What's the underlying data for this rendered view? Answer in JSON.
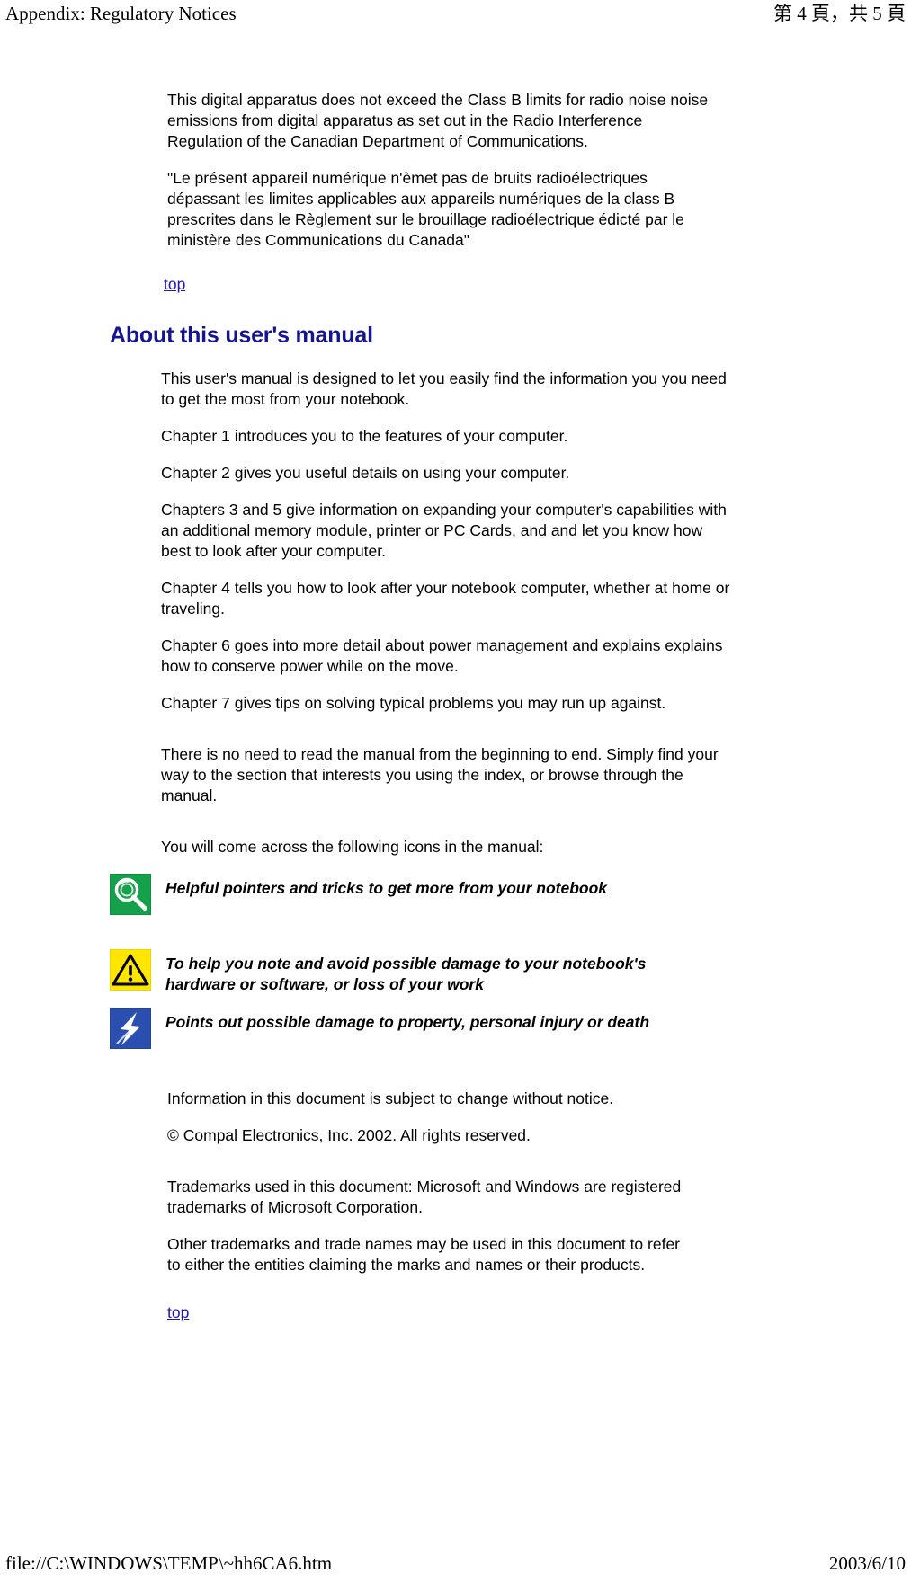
{
  "header": {
    "left_title": "Appendix: Regulatory Notices",
    "right_pagination": "第 4 頁，共 5 頁"
  },
  "footer": {
    "file_path": "file://C:\\WINDOWS\\TEMP\\~hh6CA6.htm",
    "date": "2003/6/10"
  },
  "colors": {
    "heading_navy": "#151590",
    "link_blue": "#2014b4",
    "icon_green": "#14a04a",
    "icon_yellow": "#ffe500",
    "icon_blue": "#2a4fb0",
    "page_background": "#ffffff",
    "body_text": "#000000"
  },
  "regulatory": {
    "paragraphs": [
      "This digital apparatus does not exceed the Class B limits for radio noise noise emissions from digital apparatus as set out in the Radio Interference Regulation of the Canadian Department of Communications.",
      "\"Le présent appareil numérique n'èmet pas de bruits radioélectriques dépassant les limites applicables aux appareils numériques de la class B prescrites dans le Règlement sur le brouillage radioélectrique édicté par le ministère des Communications du Canada\""
    ],
    "top_link": "top"
  },
  "about_section": {
    "heading": "About this user's manual",
    "paragraphs": [
      "This user's manual is designed to let you easily find the information you you need to get the most from your notebook.",
      "Chapter 1 introduces you to the features of your computer.",
      "Chapter 2 gives you useful details on using your computer.",
      "Chapters 3 and 5 give information on expanding your computer's capabilities with an additional memory module, printer or PC Cards, and and let you know how best to look after your computer.",
      "Chapter 4 tells you how to look after your notebook computer, whether at home or traveling.",
      "Chapter 6 goes into more detail about power management and explains explains how to conserve power while on the move.",
      "Chapter 7 gives tips on solving typical problems you may run up against.",
      "There is no need to read the manual from the beginning to end. Simply find your way to the section that interests you using the index, or browse through the manual.",
      "You will come across the following icons in the manual:"
    ]
  },
  "icon_legend": [
    {
      "icon_name": "magnifier-tip-icon",
      "icon_kind": "magnifier",
      "text": "Helpful pointers and tricks to get more from your notebook"
    },
    {
      "icon_name": "warning-triangle-icon",
      "icon_kind": "warning",
      "text": "To help you note and avoid possible damage to your notebook's hardware or software, or loss of your work"
    },
    {
      "icon_name": "lightning-bolt-danger-icon",
      "icon_kind": "lightning",
      "text": "Points out possible damage to property, personal injury or death"
    }
  ],
  "legal": {
    "paragraphs": [
      "Information in this document is subject to change without notice.",
      "© Compal Electronics, Inc. 2002. All rights reserved.",
      "Trademarks used in this document: Microsoft and Windows are registered trademarks of Microsoft Corporation.",
      "Other trademarks and trade names may be used in this document to refer to either the entities claiming the marks and names or their products."
    ],
    "top_link": "top"
  }
}
